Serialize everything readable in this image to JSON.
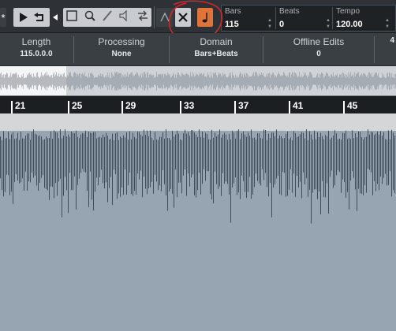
{
  "toolbar": {
    "tools": [
      {
        "name": "play-icon"
      },
      {
        "name": "loop-icon"
      },
      {
        "name": "range-select-icon"
      },
      {
        "name": "zoom-icon"
      },
      {
        "name": "pencil-icon"
      },
      {
        "name": "speaker-icon"
      },
      {
        "name": "scrub-icon"
      },
      {
        "name": "snap-icon"
      },
      {
        "name": "close-x-icon"
      },
      {
        "name": "musical-mode-icon",
        "active": true,
        "color": "#e0733a"
      }
    ],
    "fields": {
      "bars_label": "Bars",
      "bars_value": "115",
      "beats_label": "Beats",
      "beats_value": "0",
      "tempo_label": "Tempo",
      "tempo_value": "120.00"
    }
  },
  "infobar": {
    "columns": [
      {
        "header": "Length",
        "value": "115.0.0.0"
      },
      {
        "header": "Processing",
        "value": "None"
      },
      {
        "header": "Domain",
        "value": "Bars+Beats"
      },
      {
        "header": "Offline Edits",
        "value": "0"
      },
      {
        "header": "",
        "value": "4"
      }
    ]
  },
  "ruler": {
    "labels": [
      "21",
      "25",
      "29",
      "33",
      "37",
      "41",
      "45"
    ]
  },
  "colors": {
    "annotation": "#d0282c",
    "waveform_bg": "#97a5b3",
    "waveform_line": "#3f4c59"
  }
}
